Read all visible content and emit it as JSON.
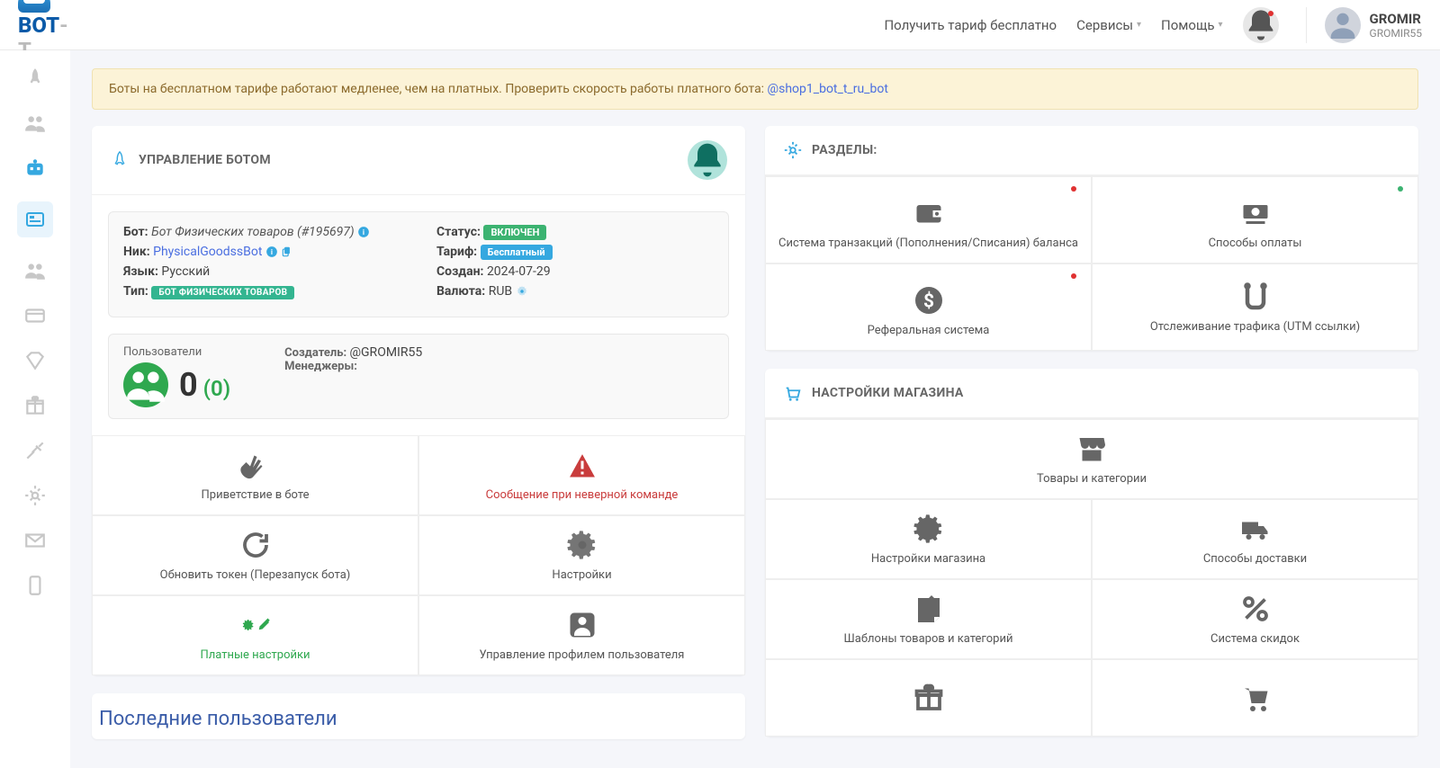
{
  "header": {
    "tariff_link": "Получить тариф бесплатно",
    "services": "Сервисы",
    "help": "Помощь",
    "user_name": "GROMIR",
    "user_sub": "GROMIR55",
    "logo_a": "BOT",
    "logo_b": "-T"
  },
  "alert": {
    "text": "Боты на бесплатном тарифе работают медленее, чем на платных. Проверить скорость работы платного бота: ",
    "link": "@shop1_bot_t_ru_bot"
  },
  "bot_card": {
    "title": "УПРАВЛЕНИЕ БОТОМ",
    "bot_label": "Бот: ",
    "bot_name": "Бот Физических товаров (#195697)",
    "nick_label": "Ник: ",
    "nick_value": "PhysicalGoodssBot",
    "lang_label": "Язык: ",
    "lang_value": "Русский",
    "type_label": "Тип: ",
    "type_value": "БОТ ФИЗИЧЕСКИХ ТОВАРОВ",
    "status_label": "Статус: ",
    "status_value": "ВКЛЮЧЕН",
    "tariff_label": "Тариф: ",
    "tariff_value": "Бесплатный",
    "created_label": "Создан: ",
    "created_value": "2024-07-29",
    "currency_label": "Валюта: ",
    "currency_value": "RUB",
    "users_title": "Пользователи",
    "users_count": "0",
    "users_paren": "(0)",
    "creator_label": "Создатель: ",
    "creator_value": "@GROMIR55",
    "managers_label": "Менеджеры:",
    "tiles": {
      "welcome": "Приветствие в боте",
      "wrong_cmd": "Сообщение при неверной команде",
      "refresh": "Обновить токен (Перезапуск бота)",
      "settings": "Настройки",
      "paid_settings": "Платные настройки",
      "profile_mgmt": "Управление профилем пользователя"
    }
  },
  "sections_card": {
    "title": "РАЗДЕЛЫ:",
    "tiles": {
      "transactions": "Система транзакций (Пополнения/Списания) баланса",
      "payments": "Способы оплаты",
      "referral": "Реферальная система",
      "tracking": "Отслеживание трафика (UTM ссылки)"
    }
  },
  "shop_card": {
    "title": "НАСТРОЙКИ МАГАЗИНА",
    "tiles": {
      "goods": "Товары и категории",
      "shop_settings": "Настройки магазина",
      "delivery": "Способы доставки",
      "templates": "Шаблоны товаров и категорий",
      "discounts": "Система скидок"
    }
  },
  "last_users": "Последние пользователи"
}
